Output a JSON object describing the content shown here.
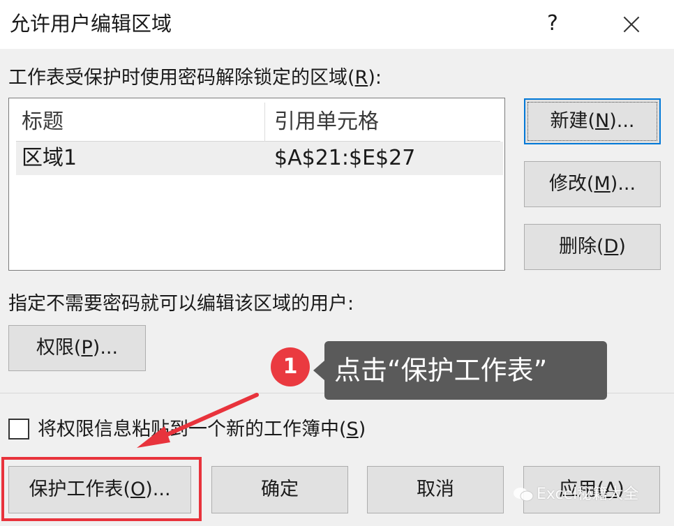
{
  "dialog": {
    "title": "允许用户编辑区域",
    "help_label": "?",
    "ranges_label_pre": "工作表受保护时使用密码解除锁定的区域(",
    "ranges_label_key": "R",
    "ranges_label_post": "):",
    "list": {
      "columns": [
        "标题",
        "引用单元格"
      ],
      "rows": [
        {
          "title": "区域1",
          "ref": "$A$21:$E$27"
        }
      ]
    },
    "buttons": {
      "new": {
        "pre": "新建(",
        "key": "N",
        "post": ")..."
      },
      "modify": {
        "pre": "修改(",
        "key": "M",
        "post": ")..."
      },
      "delete": {
        "pre": "删除(",
        "key": "D",
        "post": ")"
      },
      "permissions": {
        "pre": "权限(",
        "key": "P",
        "post": ")..."
      },
      "protect_sheet": {
        "pre": "保护工作表(",
        "key": "O",
        "post": ")..."
      },
      "ok": "确定",
      "cancel": "取消",
      "apply": {
        "pre": "应用(",
        "key": "A",
        "post": ")"
      }
    },
    "users_label": "指定不需要密码就可以编辑该区域的用户:",
    "paste_checkbox": {
      "checked": false,
      "label_pre": "将权限信息粘贴到一个新的工作簿中(",
      "label_key": "S",
      "label_post": ")"
    }
  },
  "annotation": {
    "step_number": "1",
    "tooltip_text": "点击“保护工作表”",
    "colors": {
      "badge": "#ea3a40",
      "highlight": "#e8333c",
      "tooltip_bg": "#5a5a5a"
    }
  },
  "watermark": {
    "text": "Excel秘籍大全",
    "icon": "wechat-icon"
  }
}
